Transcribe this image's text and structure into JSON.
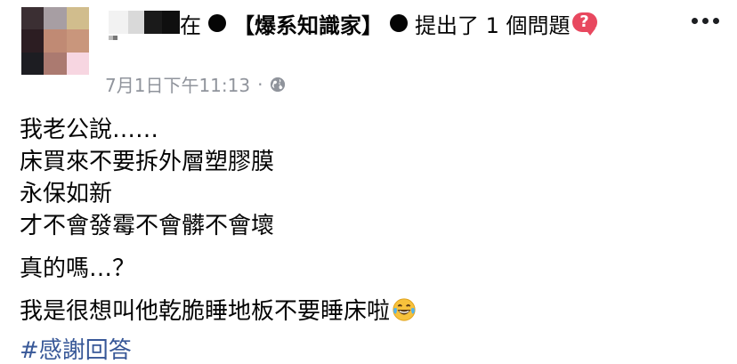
{
  "header": {
    "preposition": "在",
    "group_name": "【爆系知識家】",
    "action": "提出了 1 個問題",
    "question_emoji": "?",
    "more_icon": "more-dots-icon"
  },
  "meta": {
    "timestamp": "7月1日下午11:13",
    "separator": "·",
    "privacy_icon": "globe-icon"
  },
  "post": {
    "paragraph1": [
      "我老公說……",
      "床買來不要拆外層塑膠膜",
      "永保如新",
      "才不會發霉不會髒不會壞"
    ],
    "paragraph2": "真的嗎…？",
    "paragraph3": "我是很想叫他乾脆睡地板不要睡床啦",
    "emoji": "laughing-tears-emoji",
    "hashtag": "#感謝回答"
  },
  "colors": {
    "text": "#050505",
    "meta": "#90949c",
    "link": "#385898",
    "question_badge": "#e8485f"
  }
}
